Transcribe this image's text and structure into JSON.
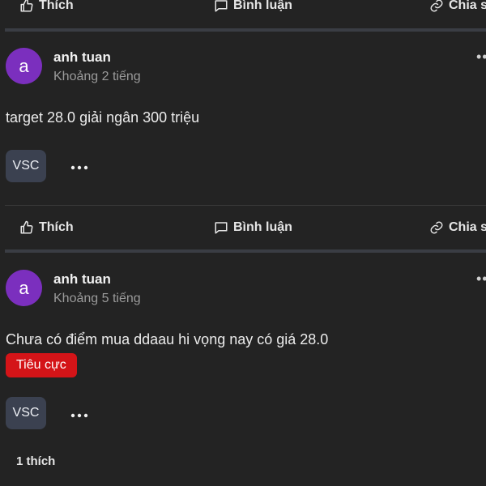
{
  "actions": {
    "like_label": "Thích",
    "comment_label": "Bình luận",
    "share_label": "Chia sẻ"
  },
  "posts": [
    {
      "avatar_letter": "a",
      "author": "anh tuan",
      "time": "Khoảng 2 tiếng",
      "content": "target 28.0 giải ngân 300 triệu",
      "ticker": "VSC"
    },
    {
      "avatar_letter": "a",
      "author": "anh tuan",
      "time": "Khoảng 5 tiếng",
      "content": "Chưa có điểm mua ddaau hi vọng nay có giá 28.0",
      "sentiment": "Tiêu cực",
      "ticker": "VSC",
      "likes": "1 thích"
    }
  ],
  "colors": {
    "background": "#232323",
    "avatar": "#7b2fbe",
    "sentiment_negative": "#d41418",
    "ticker_chip": "#3b4150"
  },
  "icons": [
    "thumbs-up-icon",
    "comment-icon",
    "link-icon",
    "more-icon"
  ]
}
